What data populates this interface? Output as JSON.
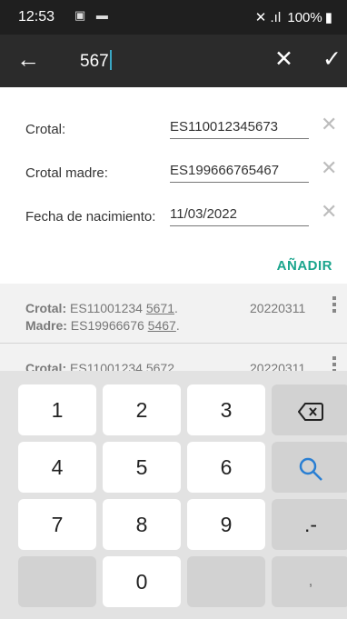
{
  "status_bar": {
    "time": "12:53",
    "notification_icons": "▣ ▬",
    "system_icons": "✕ .ıl",
    "battery": "100%"
  },
  "toolbar": {
    "back_icon": "←",
    "search_value": "567",
    "clear_icon": "✕",
    "confirm_icon": "✓"
  },
  "form": {
    "fields": [
      {
        "label": "Crotal:",
        "value": "ES110012345673"
      },
      {
        "label": "Crotal madre:",
        "value": "ES199666765467"
      },
      {
        "label": "Fecha de nacimiento:",
        "value": "11/03/2022"
      }
    ],
    "add_label": "AÑADIR"
  },
  "list": {
    "items": [
      {
        "crotal_label": "Crotal:",
        "crotal_prefix": "ES11001234",
        "crotal_suffix": "5671",
        "madre_label": "Madre:",
        "madre_prefix": "ES19966676",
        "madre_suffix": "5467",
        "date": "20220311"
      },
      {
        "crotal_label": "Crotal:",
        "crotal_prefix": "ES11001234",
        "crotal_suffix": "5672",
        "date": "20220311"
      }
    ]
  },
  "keyboard": {
    "keys": [
      "1",
      "2",
      "3",
      "⌫",
      "4",
      "5",
      "6",
      "Q",
      "7",
      "8",
      "9",
      ".-",
      "",
      "0",
      ","
    ]
  },
  "colors": {
    "status_bar_bg": "#1f1f1f",
    "toolbar_bg": "#2b2b2b",
    "accent": "#1aa58d",
    "list_bg": "#f2f2f2",
    "keyboard_bg": "#e2e2e2",
    "search_key": "#2a7fd3"
  }
}
